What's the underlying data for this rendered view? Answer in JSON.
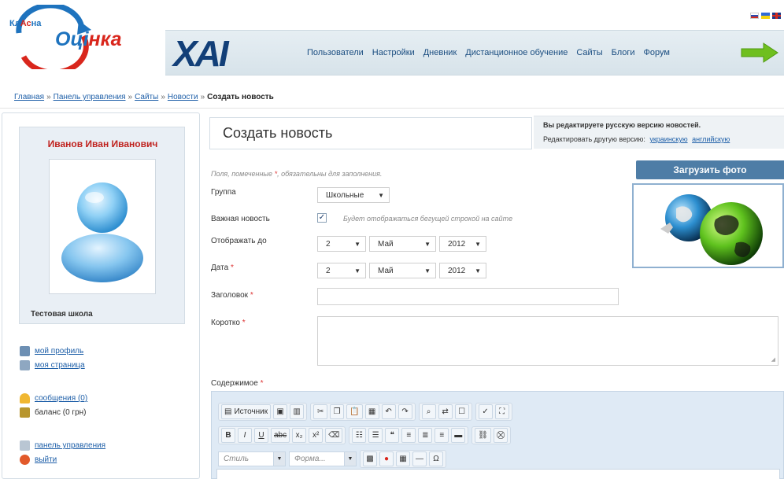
{
  "logo": {
    "klas_part1": "Кл",
    "klas_part2": "Ас",
    "klas_part3": "на",
    "ocinka_part1": "Оці",
    "ocinka_part2": "нка"
  },
  "brand": {
    "xai": "XAI"
  },
  "nav": {
    "items": [
      "Пользователи",
      "Настройки",
      "Дневник",
      "Дистанционное обучение",
      "Сайты",
      "Блоги",
      "Форум"
    ]
  },
  "breadcrumb": {
    "items": [
      "Главная",
      "Панель управления",
      "Сайты",
      "Новости"
    ],
    "separator": "»",
    "current": "Создать новость"
  },
  "sidebar": {
    "user_name": "Иванов Иван Иванович",
    "school": "Тестовая школа",
    "links": {
      "profile": "мой профиль",
      "page": "моя страница",
      "messages": "сообщения (0)",
      "balance": "баланс (0 грн)",
      "panel": "панель управления",
      "logout": "выйти"
    }
  },
  "main": {
    "title": "Создать новость",
    "version_notice": "Вы редактируете русскую версию новостей.",
    "edit_other_label": "Редактировать другую версию:",
    "edit_other_links": [
      "украинскую",
      "английскую"
    ],
    "required_note_pre": "Поля, помеченные",
    "required_star": "*",
    "required_note_post": ", обязательны для заполнения.",
    "upload_button": "Загрузить фото",
    "fields": {
      "group_label": "Группа",
      "group_value": "Школьные",
      "important_label": "Важная новость",
      "important_note": "Будет отображаться бегущей строкой на сайте",
      "display_until_label": "Отображать до",
      "display_until": {
        "day": "2",
        "month": "Май",
        "year": "2012"
      },
      "date_label": "Дата",
      "date": {
        "day": "2",
        "month": "Май",
        "year": "2012"
      },
      "heading_label": "Заголовок",
      "short_label": "Коротко",
      "content_label": "Содержимое"
    },
    "star": "*"
  },
  "editor": {
    "source_label": "Источник",
    "bold": "B",
    "italic": "I",
    "underline": "U",
    "strike": "abc",
    "subscript": "x₂",
    "superscript": "x²",
    "styles_placeholder": "Стиль",
    "format_placeholder": "Форма..."
  }
}
